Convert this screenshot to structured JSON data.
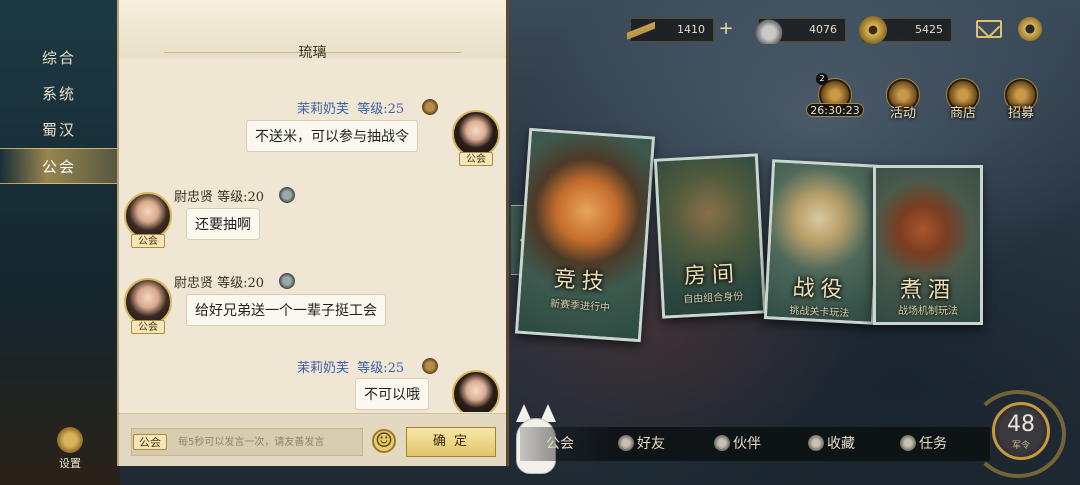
{
  "side_nav": {
    "items": [
      "综合",
      "系统",
      "蜀汉",
      "公会"
    ],
    "active_index": 3,
    "settings_label": "设置"
  },
  "chat": {
    "title": "琉璃",
    "messages": [
      {
        "sender": "茉莉奶芙",
        "level": "等级:25",
        "text": "不送米，可以参与抽战令",
        "guild": "公会",
        "self": true
      },
      {
        "sender": "尉忠贤",
        "level": "等级:20",
        "text": "还要抽啊",
        "guild": "公会",
        "self": false
      },
      {
        "sender": "尉忠贤",
        "level": "等级:20",
        "text": "给好兄弟送一个一辈子挺工会",
        "guild": "公会",
        "self": false
      },
      {
        "sender": "茉莉奶芙",
        "level": "等级:25",
        "text": "不可以哦",
        "guild": "公会",
        "self": true
      }
    ],
    "input": {
      "channel": "公会",
      "placeholder": "每5秒可以发言一次，请友善发言"
    },
    "confirm_label": "确 定"
  },
  "resources": {
    "tokens": "1410",
    "cart": "4076",
    "coins": "5425",
    "plus_label": "+"
  },
  "shortcuts": {
    "season_badge": "2",
    "season_timer": "26:30:23",
    "activity": "活动",
    "shop": "商店",
    "recruit": "招募"
  },
  "modes": [
    {
      "title": "竞技",
      "sub": "新赛季进行中"
    },
    {
      "title": "房间",
      "sub": "自由组合身份"
    },
    {
      "title": "战役",
      "sub": "挑战关卡玩法"
    },
    {
      "title": "煮酒",
      "sub": "战场机制玩法"
    }
  ],
  "bottom_nav": [
    "公会",
    "好友",
    "伙伴",
    "收藏",
    "任务"
  ],
  "orders": {
    "count": "48",
    "label": "军令"
  },
  "colors": {
    "self_name": "#3d5ea8",
    "panel_bg": "#efe7d3",
    "accent_gold": "#d8b55a"
  }
}
